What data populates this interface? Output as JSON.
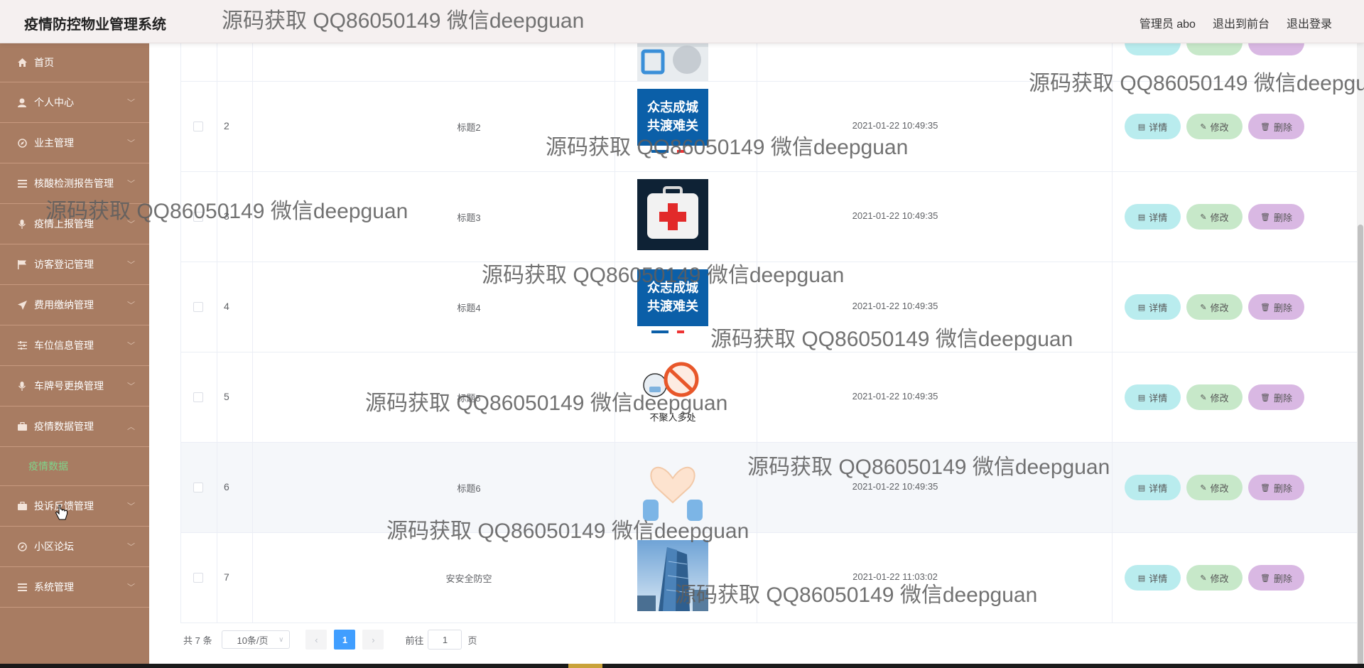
{
  "app": {
    "title": "疫情防控物业管理系统"
  },
  "top_nav": {
    "admin": "管理员 abo",
    "exit_front": "退出到前台",
    "logout": "退出登录"
  },
  "sidebar": {
    "items": [
      {
        "label": "首页",
        "icon": "home-icon"
      },
      {
        "label": "个人中心",
        "icon": "user-icon"
      },
      {
        "label": "业主管理",
        "icon": "compass-icon"
      },
      {
        "label": "核酸检测报告管理",
        "icon": "list-icon"
      },
      {
        "label": "疫情上报管理",
        "icon": "mic-icon"
      },
      {
        "label": "访客登记管理",
        "icon": "flag-icon"
      },
      {
        "label": "费用缴纳管理",
        "icon": "send-icon"
      },
      {
        "label": "车位信息管理",
        "icon": "sliders-icon"
      },
      {
        "label": "车牌号更换管理",
        "icon": "mic-icon"
      },
      {
        "label": "疫情数据管理",
        "icon": "briefcase-icon"
      },
      {
        "label": "投诉反馈管理",
        "icon": "briefcase-icon"
      },
      {
        "label": "小区论坛",
        "icon": "compass-icon"
      },
      {
        "label": "系统管理",
        "icon": "list-icon"
      }
    ],
    "submenu_active": "疫情数据"
  },
  "table": {
    "rows": [
      {
        "index": "2",
        "title": "标题2",
        "time": "2021-01-22 10:49:35",
        "image": "众志成城共渡难关 poster"
      },
      {
        "index": "3",
        "title": "标题3",
        "time": "2021-01-22 10:49:35",
        "image": "first aid kit"
      },
      {
        "index": "4",
        "title": "标题4",
        "time": "2021-01-22 10:49:35",
        "image": "众志成城共渡难关 poster"
      },
      {
        "index": "5",
        "title": "标题5",
        "time": "2021-01-22 10:49:35",
        "image": "不聚人多处 illustration"
      },
      {
        "index": "6",
        "title": "标题6",
        "time": "2021-01-22 10:49:35",
        "image": "heart hands"
      },
      {
        "index": "7",
        "title": "安安全防空",
        "time": "2021-01-22 11:03:02",
        "image": "skyscraper"
      }
    ],
    "actions": {
      "detail": "详情",
      "edit": "修改",
      "delete": "删除"
    },
    "poster_text": {
      "line1": "众志成城",
      "line2": "共渡难关",
      "bottom": "不聚人多处"
    }
  },
  "pagination": {
    "total": "共 7 条",
    "page_size": "10条/页",
    "current": "1",
    "goto": "前往",
    "goto_value": "1",
    "page_suffix": "页"
  },
  "watermark": "源码获取 QQ86050149 微信deepguan",
  "colors": {
    "sidebar": "#a87c62",
    "topbar": "#f5f0f0",
    "detail_btn": "#b9ecee",
    "edit_btn": "#c7e8c9",
    "delete_btn": "#d9b8e3",
    "active_submenu": "#7fd48b",
    "page_active": "#409eff"
  }
}
